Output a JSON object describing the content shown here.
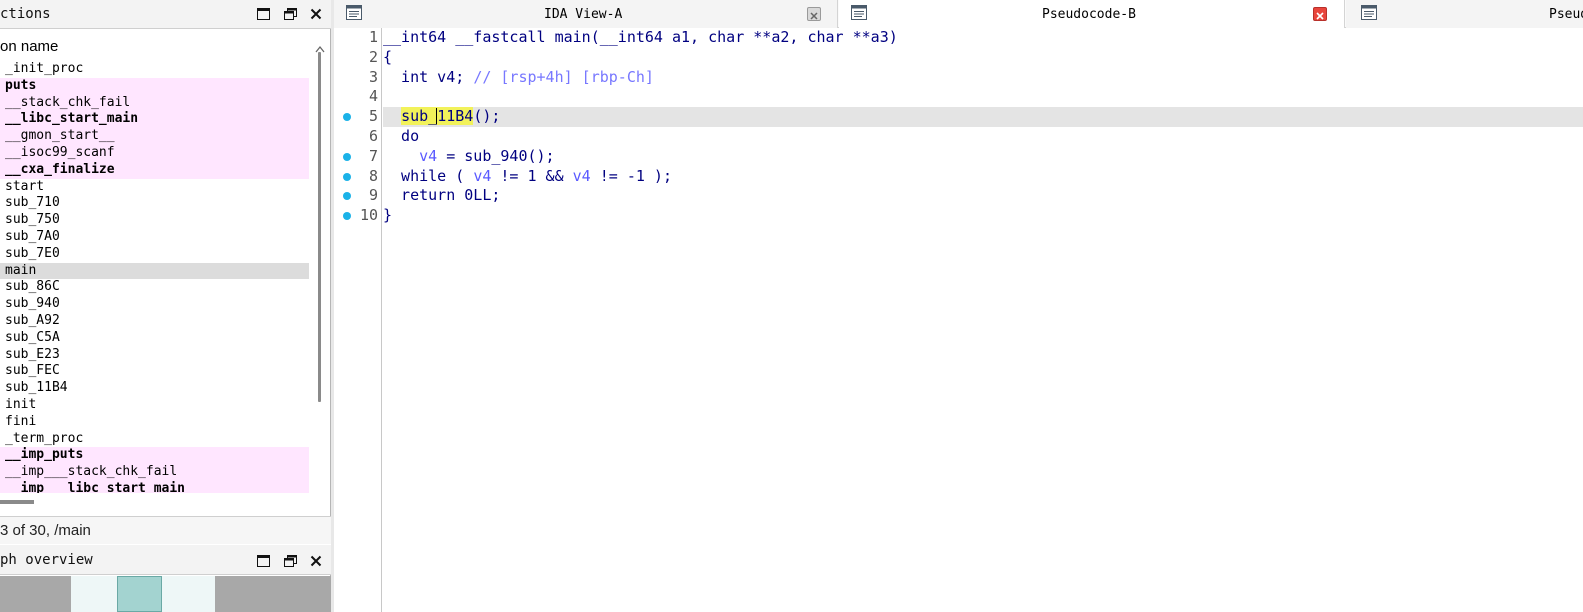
{
  "functions_panel": {
    "title": "ctions",
    "column_header": "on name",
    "items": [
      {
        "name": "_init_proc",
        "lib": false,
        "bold": false
      },
      {
        "name": "puts",
        "lib": true,
        "bold": true
      },
      {
        "name": "__stack_chk_fail",
        "lib": true,
        "bold": false
      },
      {
        "name": "__libc_start_main",
        "lib": true,
        "bold": true
      },
      {
        "name": "__gmon_start__",
        "lib": true,
        "bold": false
      },
      {
        "name": "__isoc99_scanf",
        "lib": true,
        "bold": false
      },
      {
        "name": "__cxa_finalize",
        "lib": true,
        "bold": true
      },
      {
        "name": "start",
        "lib": false,
        "bold": false
      },
      {
        "name": "sub_710",
        "lib": false,
        "bold": false
      },
      {
        "name": "sub_750",
        "lib": false,
        "bold": false
      },
      {
        "name": "sub_7A0",
        "lib": false,
        "bold": false
      },
      {
        "name": "sub_7E0",
        "lib": false,
        "bold": false
      },
      {
        "name": "main",
        "lib": false,
        "bold": false,
        "selected": true
      },
      {
        "name": "sub_86C",
        "lib": false,
        "bold": false
      },
      {
        "name": "sub_940",
        "lib": false,
        "bold": false
      },
      {
        "name": "sub_A92",
        "lib": false,
        "bold": false
      },
      {
        "name": "sub_C5A",
        "lib": false,
        "bold": false
      },
      {
        "name": "sub_E23",
        "lib": false,
        "bold": false
      },
      {
        "name": "sub_FEC",
        "lib": false,
        "bold": false
      },
      {
        "name": "sub_11B4",
        "lib": false,
        "bold": false
      },
      {
        "name": "init",
        "lib": false,
        "bold": false
      },
      {
        "name": "fini",
        "lib": false,
        "bold": false
      },
      {
        "name": "_term_proc",
        "lib": false,
        "bold": false
      },
      {
        "name": "__imp_puts",
        "lib": true,
        "bold": true
      },
      {
        "name": "__imp___stack_chk_fail",
        "lib": true,
        "bold": false
      },
      {
        "name": "__imp___libc_start_main",
        "lib": true,
        "bold": true
      }
    ],
    "status": "3 of 30, /main"
  },
  "graph_panel": {
    "title": "ph overview"
  },
  "tabs": [
    {
      "label": "IDA View-A",
      "active": false,
      "close_style": "gray"
    },
    {
      "label": "Pseudocode-B",
      "active": true,
      "close_style": "red"
    },
    {
      "label": "Pseudo",
      "active": false,
      "close_style": "none"
    }
  ],
  "code": {
    "lines": [
      {
        "num": "1",
        "bp": false,
        "current": false,
        "tokens": [
          [
            "kw",
            "__int64 __fastcall main(__int64 a1, char **a2, char **a3)"
          ]
        ]
      },
      {
        "num": "2",
        "bp": false,
        "current": false,
        "tokens": [
          [
            "kw",
            "{"
          ]
        ]
      },
      {
        "num": "3",
        "bp": false,
        "current": false,
        "tokens": [
          [
            "kw",
            "  int v4; "
          ],
          [
            "cmt",
            "// [rsp+4h] [rbp-Ch]"
          ]
        ]
      },
      {
        "num": "4",
        "bp": false,
        "current": false,
        "tokens": []
      },
      {
        "num": "5",
        "bp": true,
        "current": true,
        "tokens": [
          [
            "kw",
            "  "
          ],
          [
            "hl",
            "sub_"
          ],
          [
            "caret",
            ""
          ],
          [
            "hl",
            "11B4"
          ],
          [
            "kw",
            "();"
          ]
        ]
      },
      {
        "num": "6",
        "bp": false,
        "current": false,
        "tokens": [
          [
            "kw",
            "  do"
          ]
        ]
      },
      {
        "num": "7",
        "bp": true,
        "current": false,
        "tokens": [
          [
            "kw",
            "    "
          ],
          [
            "var",
            "v4"
          ],
          [
            "kw",
            " = sub_940();"
          ]
        ]
      },
      {
        "num": "8",
        "bp": true,
        "current": false,
        "tokens": [
          [
            "kw",
            "  while ( "
          ],
          [
            "var",
            "v4"
          ],
          [
            "kw",
            " != 1 && "
          ],
          [
            "var",
            "v4"
          ],
          [
            "kw",
            " != -1 );"
          ]
        ]
      },
      {
        "num": "9",
        "bp": true,
        "current": false,
        "tokens": [
          [
            "kw",
            "  return 0LL;"
          ]
        ]
      },
      {
        "num": "10",
        "bp": true,
        "current": false,
        "tokens": [
          [
            "kw",
            "}"
          ]
        ]
      }
    ]
  },
  "colors": {
    "lib_row": "#ffe6ff",
    "selected_row": "#dcdcdc",
    "breakpoint": "#1ab2e8",
    "highlight": "#f2f25a",
    "code_text": "#000080",
    "variable": "#5a5aff",
    "tab_close_red": "#e8453c"
  },
  "icons": [
    "maximize-icon",
    "restore-icon",
    "close-icon",
    "tab-view-icon",
    "scroll-up-arrow-icon"
  ]
}
